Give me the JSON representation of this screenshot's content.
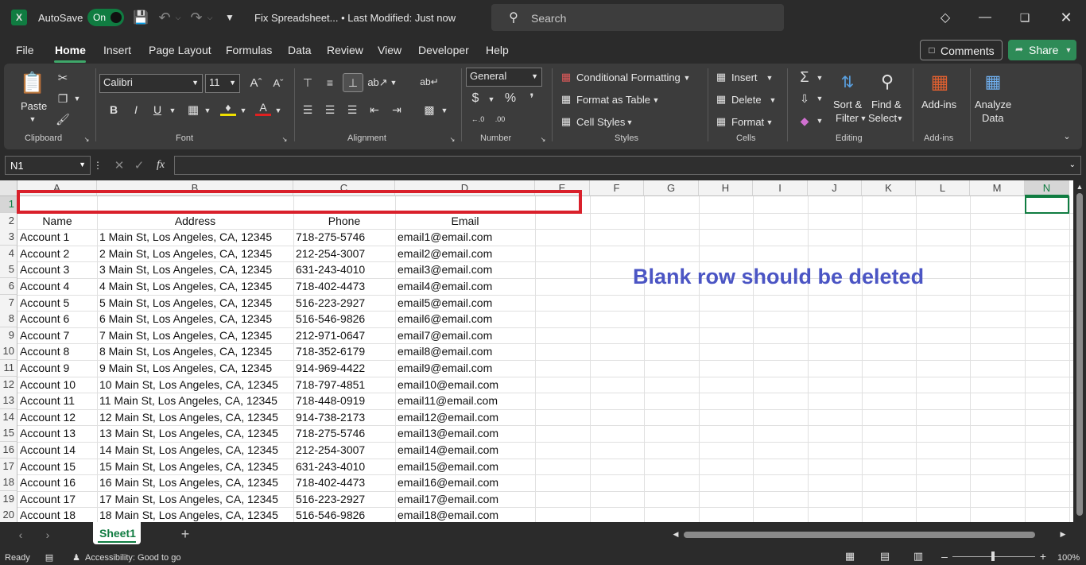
{
  "titlebar": {
    "autosave_label": "AutoSave",
    "autosave_state": "On",
    "doc_title": "Fix Spreadsheet... • Last Modified: Just now",
    "search_placeholder": "Search"
  },
  "menu": {
    "tabs": [
      "File",
      "Home",
      "Insert",
      "Page Layout",
      "Formulas",
      "Data",
      "Review",
      "View",
      "Developer",
      "Help"
    ],
    "active": "Home",
    "comments_label": "Comments",
    "share_label": "Share"
  },
  "ribbon": {
    "clipboard": {
      "paste": "Paste",
      "label": "Clipboard"
    },
    "font": {
      "family": "Calibri",
      "size": "11",
      "label": "Font"
    },
    "alignment": {
      "label": "Alignment"
    },
    "number": {
      "format": "General",
      "label": "Number"
    },
    "styles": {
      "cond": "Conditional Formatting",
      "table": "Format as Table",
      "cell": "Cell Styles",
      "label": "Styles"
    },
    "cells": {
      "insert": "Insert",
      "delete": "Delete",
      "format": "Format",
      "label": "Cells"
    },
    "editing": {
      "sort": "Sort &",
      "filter": "Filter",
      "find": "Find &",
      "select": "Select",
      "label": "Editing"
    },
    "addins": {
      "btn": "Add-ins",
      "label": "Add-ins"
    },
    "analyze": {
      "line1": "Analyze",
      "line2": "Data"
    }
  },
  "formula": {
    "namebox": "N1",
    "fx": "fx",
    "value": ""
  },
  "grid": {
    "columns": [
      "A",
      "B",
      "C",
      "D",
      "E",
      "F",
      "G",
      "H",
      "I",
      "J",
      "K",
      "L",
      "M",
      "N"
    ],
    "headers": [
      "Name",
      "Address",
      "Phone",
      "Email"
    ],
    "rows": [
      [
        "Account 1",
        "1 Main St, Los Angeles, CA, 12345",
        "718-275-5746",
        "email1@email.com"
      ],
      [
        "Account 2",
        "2 Main St, Los Angeles, CA, 12345",
        "212-254-3007",
        "email2@email.com"
      ],
      [
        "Account 3",
        "3 Main St, Los Angeles, CA, 12345",
        "631-243-4010",
        "email3@email.com"
      ],
      [
        "Account 4",
        "4 Main St, Los Angeles, CA, 12345",
        "718-402-4473",
        "email4@email.com"
      ],
      [
        "Account 5",
        "5 Main St, Los Angeles, CA, 12345",
        "516-223-2927",
        "email5@email.com"
      ],
      [
        "Account 6",
        "6 Main St, Los Angeles, CA, 12345",
        "516-546-9826",
        "email6@email.com"
      ],
      [
        "Account 7",
        "7 Main St, Los Angeles, CA, 12345",
        "212-971-0647",
        "email7@email.com"
      ],
      [
        "Account 8",
        "8 Main St, Los Angeles, CA, 12345",
        "718-352-6179",
        "email8@email.com"
      ],
      [
        "Account 9",
        "9 Main St, Los Angeles, CA, 12345",
        "914-969-4422",
        "email9@email.com"
      ],
      [
        "Account 10",
        "10 Main St, Los Angeles, CA, 12345",
        "718-797-4851",
        "email10@email.com"
      ],
      [
        "Account 11",
        "11 Main St, Los Angeles, CA, 12345",
        "718-448-0919",
        "email11@email.com"
      ],
      [
        "Account 12",
        "12 Main St, Los Angeles, CA, 12345",
        "914-738-2173",
        "email12@email.com"
      ],
      [
        "Account 13",
        "13 Main St, Los Angeles, CA, 12345",
        "718-275-5746",
        "email13@email.com"
      ],
      [
        "Account 14",
        "14 Main St, Los Angeles, CA, 12345",
        "212-254-3007",
        "email14@email.com"
      ],
      [
        "Account 15",
        "15 Main St, Los Angeles, CA, 12345",
        "631-243-4010",
        "email15@email.com"
      ],
      [
        "Account 16",
        "16 Main St, Los Angeles, CA, 12345",
        "718-402-4473",
        "email16@email.com"
      ],
      [
        "Account 17",
        "17 Main St, Los Angeles, CA, 12345",
        "516-223-2927",
        "email17@email.com"
      ],
      [
        "Account 18",
        "18 Main St, Los Angeles, CA, 12345",
        "516-546-9826",
        "email18@email.com"
      ]
    ],
    "row_numbers": [
      "1",
      "2",
      "3",
      "4",
      "5",
      "6",
      "7",
      "8",
      "9",
      "10",
      "11",
      "12",
      "13",
      "14",
      "15",
      "16",
      "17",
      "18",
      "19",
      "20"
    ],
    "annotation": "Blank row should be deleted",
    "annotation_color": "#4b55c4",
    "highlight_color": "#d9202b"
  },
  "sheets": {
    "tabs": [
      "Sheet1"
    ],
    "active": "Sheet1"
  },
  "status": {
    "ready": "Ready",
    "accessibility": "Accessibility: Good to go",
    "zoom": "100%"
  },
  "colors": {
    "accent": "#107c41",
    "ribbon_bg": "#3c3c3c",
    "title_bg": "#2b2b2b"
  }
}
